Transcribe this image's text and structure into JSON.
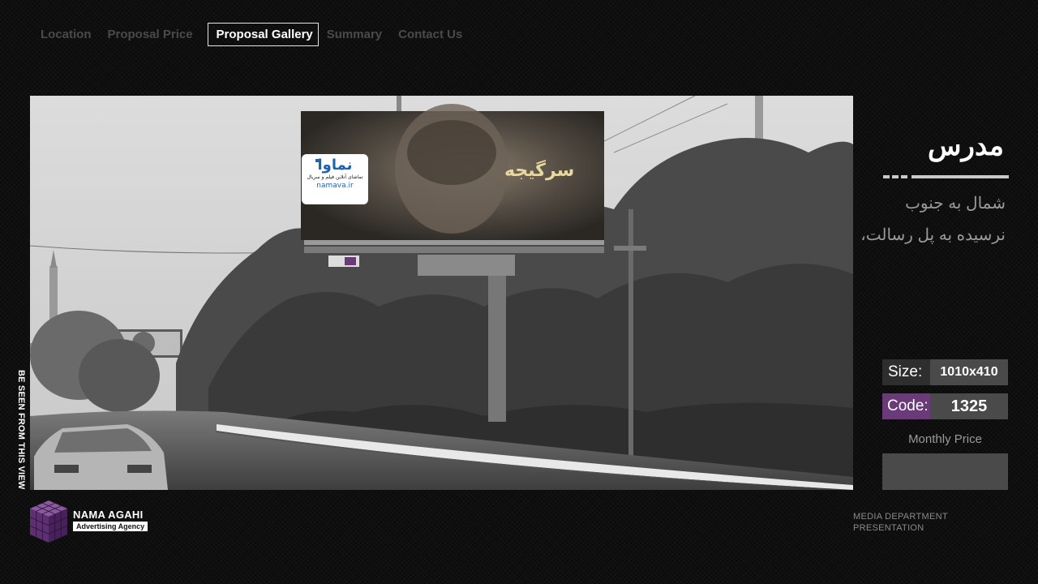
{
  "nav": {
    "items": [
      {
        "label": "Location"
      },
      {
        "label": "Proposal Price"
      },
      {
        "label": "Proposal Gallery",
        "active": true
      },
      {
        "label": "Summary"
      },
      {
        "label": "Contact Us"
      }
    ]
  },
  "photo": {
    "side_label": "BE SEEN FROM THIS VIEW",
    "billboard": {
      "brand": "نماوا",
      "brand_tagline": "تماشای آنلاین فیلم و سریال",
      "brand_url": "namava.ir",
      "headline": "سرگیجه"
    }
  },
  "panel": {
    "title": "مدرس",
    "direction": "شمال به جنوب",
    "location": "نرسیده به پل رسالت،",
    "size_label": "Size:",
    "size_value": "1010x410",
    "code_label": "Code:",
    "code_value": "1325",
    "monthly_price_label": "Monthly Price",
    "monthly_price_value": ""
  },
  "footer": {
    "logo_name": "NAMA AGAHI",
    "logo_tagline": "Advertising Agency",
    "dept_line1": "MEDIA DEPARTMENT",
    "dept_line2": "PRESENTATION"
  },
  "colors": {
    "accent_purple": "#6b3a79",
    "value_box": "#4a4a4a",
    "background": "#0c0c0c"
  }
}
